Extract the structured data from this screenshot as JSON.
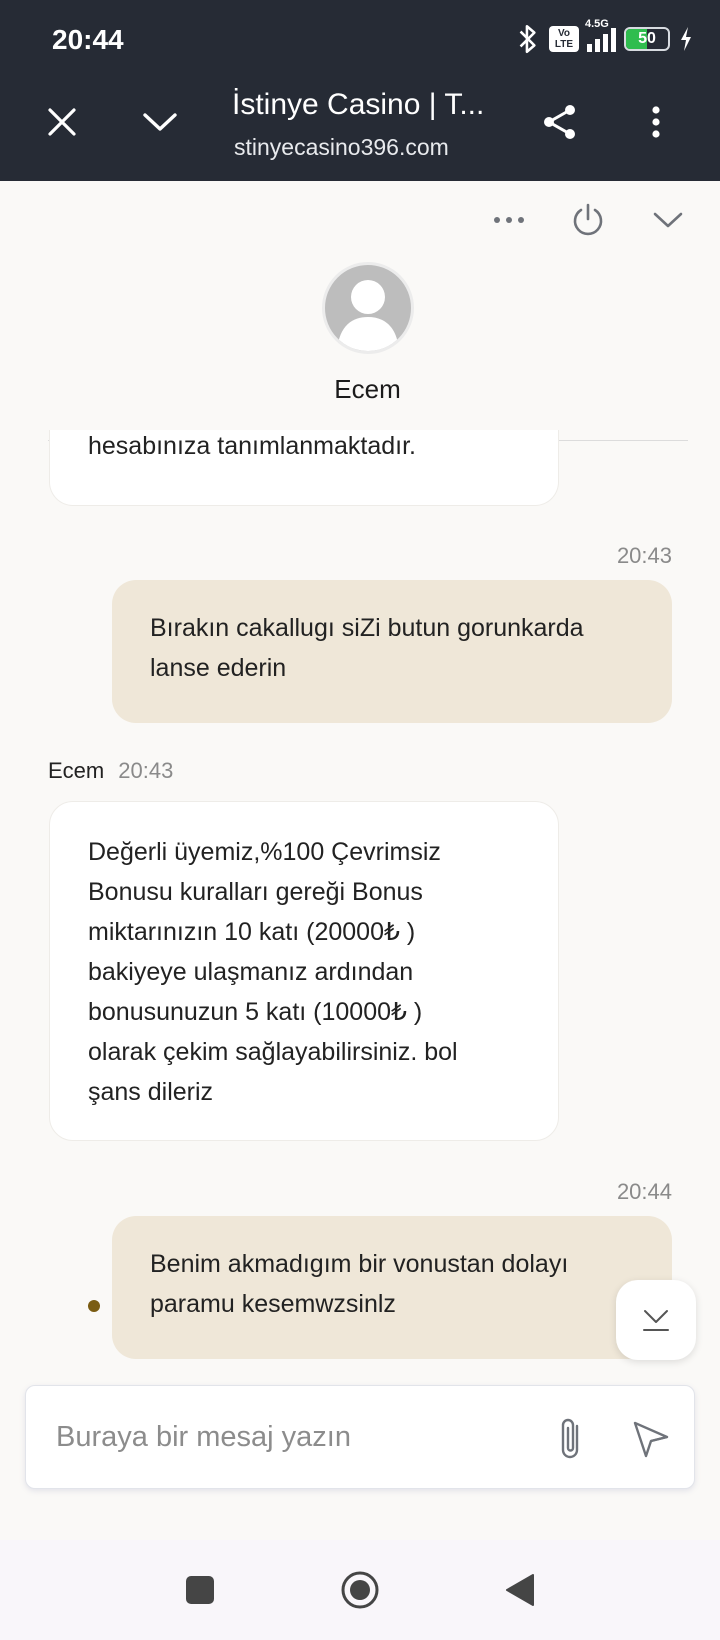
{
  "status_bar": {
    "time": "20:44",
    "volte": "Vo LTE",
    "network": "4.5G",
    "battery": "50",
    "icons": [
      "bluetooth-icon",
      "volte-icon",
      "signal-icon",
      "battery-icon",
      "charging-icon"
    ]
  },
  "browser": {
    "title": "İstinye Casino | T...",
    "url": "stinyecasino396.com",
    "icons": [
      "close-icon",
      "chevron-down-icon",
      "share-icon",
      "more-vert-icon"
    ]
  },
  "chat": {
    "agent_name": "Ecem",
    "toolbar_icons": [
      "more-horiz-icon",
      "power-icon",
      "chevron-down-icon"
    ],
    "messages": [
      {
        "type": "incoming",
        "text": "hesabınıza tanımlanmaktadır."
      },
      {
        "type": "outgoing",
        "time": "20:43",
        "lines": [
          "Bırakın cakallugı siZi butun gorunkarda",
          "lanse ederin"
        ]
      },
      {
        "type": "incoming",
        "sender": "Ecem",
        "time": "20:43",
        "lines": [
          "Değerli üyemiz,%100 Çevrimsiz",
          "Bonusu kuralları gereği Bonus",
          "miktarınızın 10 katı (20000₺ )",
          "bakiyeye ulaşmanız ardından",
          "bonusunuzun 5 katı (10000₺ )",
          "olarak çekim sağlayabilirsiniz. bol",
          "şans dileriz"
        ]
      },
      {
        "type": "outgoing",
        "time": "20:44",
        "lines": [
          "Benim akmadıgım bir vonustan dolayı",
          "paramu kesemwzsinlz"
        ]
      }
    ]
  },
  "composer": {
    "placeholder": "Buraya bir mesaj yazın",
    "value": ""
  },
  "colors": {
    "header_bg": "#262b35",
    "outgoing_bubble": "#efe7d8",
    "incoming_bubble": "#ffffff",
    "unread_dot": "#7a5c12"
  },
  "nav_icons": [
    "recents-square-icon",
    "home-circle-icon",
    "back-triangle-icon"
  ]
}
